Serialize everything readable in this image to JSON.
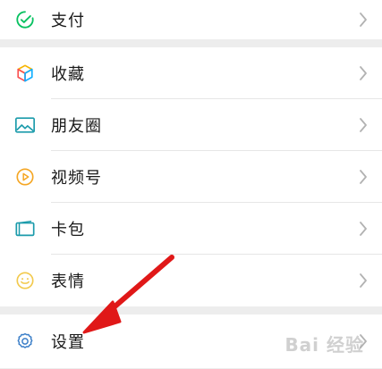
{
  "menu": {
    "pay": {
      "label": "支付",
      "icon": "pay-icon"
    },
    "favorites": {
      "label": "收藏",
      "icon": "favorites-cube-icon"
    },
    "moments": {
      "label": "朋友圈",
      "icon": "moments-image-icon"
    },
    "channels": {
      "label": "视频号",
      "icon": "channels-play-icon"
    },
    "cards": {
      "label": "卡包",
      "icon": "card-wallet-icon"
    },
    "stickers": {
      "label": "表情",
      "icon": "smiley-icon"
    },
    "settings": {
      "label": "设置",
      "icon": "gear-icon"
    }
  },
  "watermark": {
    "text": "Bai 经验"
  },
  "colors": {
    "background": "#ededed",
    "row": "#ffffff",
    "text": "#1a1a1a",
    "chevron": "#b2b2b2",
    "pay_green": "#07c160",
    "favorites_orange": "#f7b500",
    "favorites_red": "#fa5151",
    "favorites_blue": "#10aeff",
    "moments_teal": "#1b9bab",
    "channels_orange": "#f5a623",
    "cards_teal": "#1b9bab",
    "stickers_yellow": "#f2c94c",
    "settings_blue": "#3a7ec8",
    "arrow_red": "#e01818"
  }
}
